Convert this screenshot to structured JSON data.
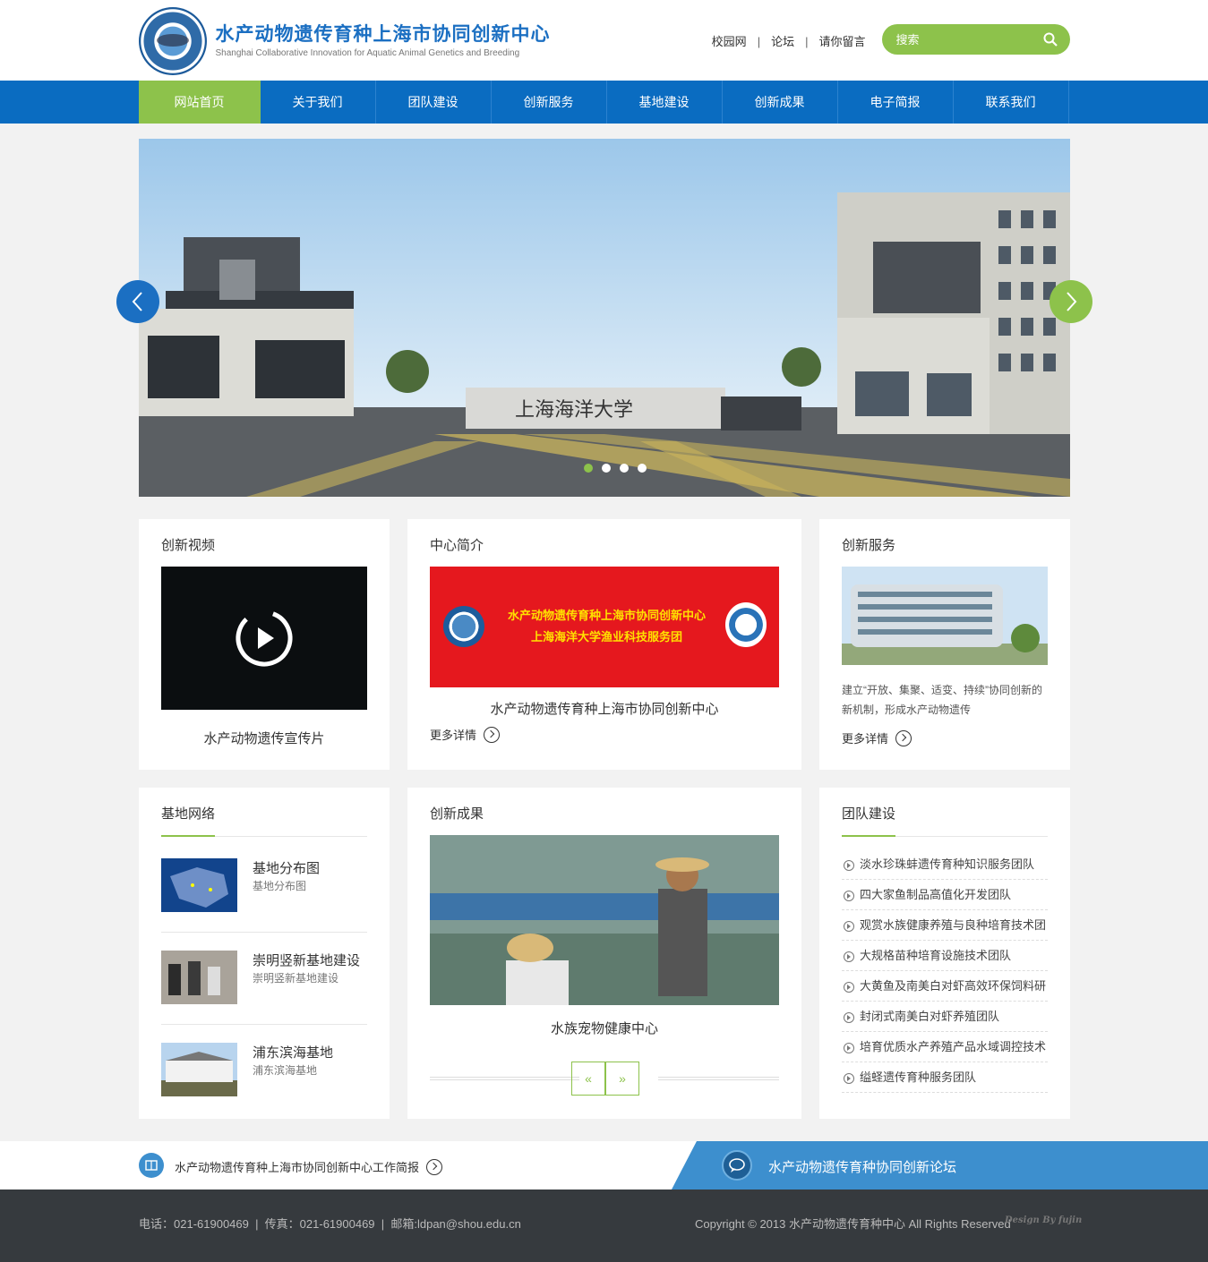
{
  "header": {
    "title": "水产动物遗传育种上海市协同创新中心",
    "subtitle": "Shanghai Collaborative Innovation for Aquatic Animal Genetics and Breeding",
    "links": [
      "校园网",
      "论坛",
      "请你留言"
    ],
    "search_placeholder": "搜索"
  },
  "nav": [
    "网站首页",
    "关于我们",
    "团队建设",
    "创新服务",
    "基地建设",
    "创新成果",
    "电子简报",
    "联系我们"
  ],
  "banner": {
    "gate_text": "上海海洋大学",
    "slide_count": 4,
    "active_slide": 1
  },
  "video": {
    "title": "创新视频",
    "caption": "水产动物遗传宣传片"
  },
  "intro": {
    "title": "中心简介",
    "banner_line1": "水产动物遗传育种上海市协同创新中心",
    "banner_line2": "上海海洋大学渔业科技服务团",
    "caption": "水产动物遗传育种上海市协同创新中心",
    "more": "更多详情"
  },
  "service": {
    "title": "创新服务",
    "text": "建立“开放、集聚、适变、持续”协同创新的新机制，形成水产动物遗传",
    "more": "更多详情"
  },
  "bases": {
    "title": "基地网络",
    "items": [
      {
        "title": "基地分布图",
        "sub": "基地分布图"
      },
      {
        "title": "崇明竖新基地建设",
        "sub": "崇明竖新基地建设"
      },
      {
        "title": "浦东滨海基地",
        "sub": "浦东滨海基地"
      }
    ]
  },
  "results": {
    "title": "创新成果",
    "caption": "水族宠物健康中心",
    "prev": "«",
    "next": "»"
  },
  "team": {
    "title": "团队建设",
    "items": [
      "淡水珍珠蚌遗传育种知识服务团队",
      "四大家鱼制品高值化开发团队",
      "观赏水族健康养殖与良种培育技术团",
      "大规格苗种培育设施技术团队",
      "大黄鱼及南美白对虾高效环保饲料研",
      "封闭式南美白对虾养殖团队",
      "培育优质水产养殖产品水域调控技术",
      "缢蛏遗传育种服务团队"
    ]
  },
  "bottom": {
    "report": "水产动物遗传育种上海市协同创新中心工作简报",
    "forum": "水产动物遗传育种协同创新论坛"
  },
  "footer": {
    "contact": "电话：021-61900469  |  传真：021-61900469  |  邮箱:ldpan@shou.edu.cn",
    "copyright": "Copyright © 2013 水产动物遗传育种中心 All Rights Reserved",
    "design": "Design By fujin"
  },
  "colors": {
    "blue": "#0a6cc1",
    "green": "#8dc24b",
    "footer": "#363a3e"
  }
}
